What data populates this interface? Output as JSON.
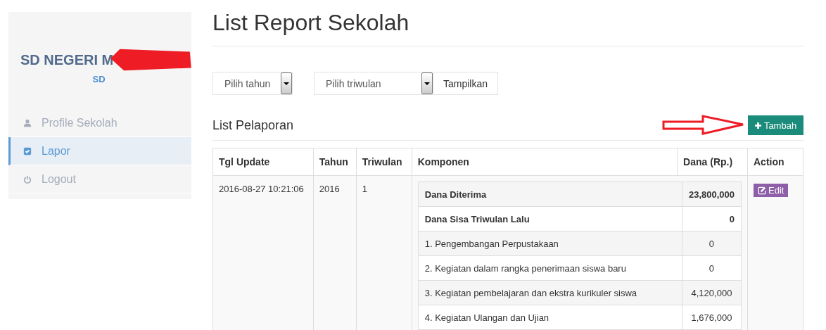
{
  "sidebar": {
    "school_name": "SD NEGERI M",
    "school_level": "SD",
    "redacted": true,
    "items": [
      {
        "label": "Profile Sekolah",
        "kind": "profile",
        "selected": false
      },
      {
        "label": "Lapor",
        "kind": "report",
        "selected": true
      },
      {
        "label": "Logout",
        "kind": "logout",
        "selected": false
      }
    ]
  },
  "page_title": "List Report Sekolah",
  "filters": {
    "year_select": {
      "placeholder": "Pilih tahun"
    },
    "quarter_select": {
      "placeholder": "Pilih triwulan"
    },
    "submit_button": "Tampilkan"
  },
  "section_title": "List Pelaporan",
  "add_button": "Tambah",
  "annotation_arrow": true,
  "table": {
    "columns": [
      "Tgl Update",
      "Tahun",
      "Triwulan",
      "Komponen",
      "Dana (Rp.)",
      "Action"
    ],
    "rows": [
      {
        "tgl_update": "2016-08-27 10:21:06",
        "tahun": "2016",
        "triwulan": "1",
        "action": "Edit",
        "components": [
          {
            "kind": "summary",
            "label": "Dana Diterima",
            "amount": "23,800,000"
          },
          {
            "kind": "summary",
            "label": "Dana Sisa Triwulan Lalu",
            "amount": "0"
          },
          {
            "kind": "item",
            "label": "1. Pengembangan Perpustakaan",
            "amount": "0"
          },
          {
            "kind": "item",
            "label": "2. Kegiatan dalam rangka penerimaan siswa baru",
            "amount": "0"
          },
          {
            "kind": "item",
            "label": "3. Kegiatan pembelajaran dan ekstra kurikuler siswa",
            "amount": "4,120,000"
          },
          {
            "kind": "item",
            "label": "4. Kegiatan Ulangan dan Ujian",
            "amount": "1,676,000"
          }
        ]
      }
    ]
  }
}
